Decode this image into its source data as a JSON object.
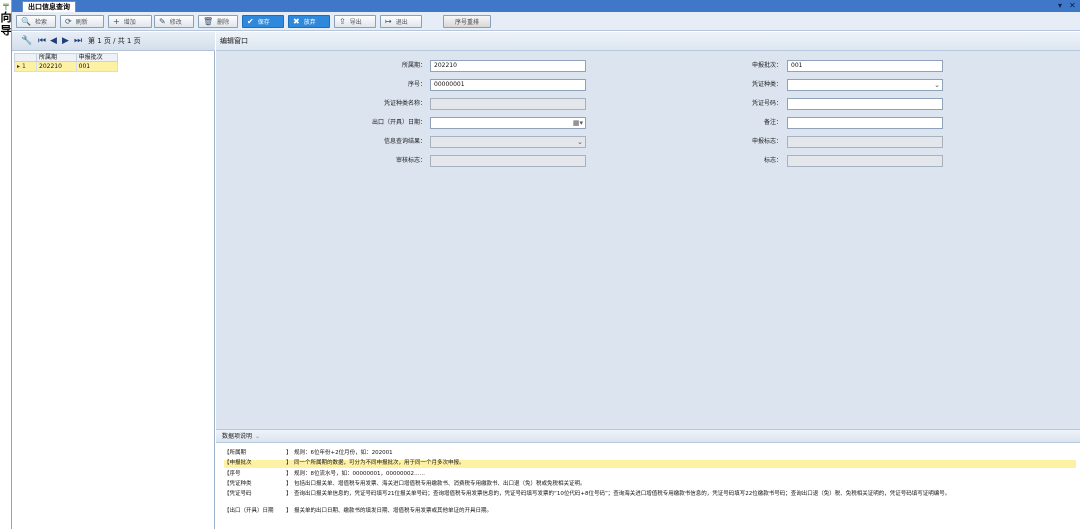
{
  "nav": {
    "label": "向导"
  },
  "tab": {
    "title": "出口信息查询"
  },
  "window_controls": {
    "dropdown": "▾",
    "close": "✕"
  },
  "toolbar": {
    "search": "检索",
    "refresh": "刷新",
    "add": "增加",
    "edit": "修改",
    "delete": "删除",
    "save": "保存",
    "discard": "放弃",
    "export": "导出",
    "exit": "退出",
    "reorder": "序号重排"
  },
  "pager": {
    "text": "第 1 页 / 共 1 页"
  },
  "grid": {
    "columns": [
      "所属期",
      "申报批次"
    ],
    "rows": [
      {
        "index": "1",
        "period": "202210",
        "batch": "001"
      }
    ]
  },
  "edit": {
    "header": "编辑窗口",
    "fields": {
      "period": {
        "label": "所属期：",
        "value": "202210"
      },
      "batch": {
        "label": "申报批次：",
        "value": "001"
      },
      "seq": {
        "label": "序号：",
        "value": "00000001"
      },
      "voucher_type": {
        "label": "凭证种类：",
        "value": ""
      },
      "voucher_type_name": {
        "label": "凭证种类名称：",
        "value": ""
      },
      "voucher_no": {
        "label": "凭证号码：",
        "value": ""
      },
      "export_date": {
        "label": "出口（开具）日期：",
        "value": ""
      },
      "remark": {
        "label": "备注：",
        "value": ""
      },
      "query_result": {
        "label": "信息查询结果：",
        "value": ""
      },
      "declare_flag": {
        "label": "申报标志：",
        "value": ""
      },
      "audit_flag": {
        "label": "审核标志：",
        "value": ""
      },
      "flag": {
        "label": "标志：",
        "value": ""
      }
    }
  },
  "desc": {
    "header": "数据项说明",
    "bracket": "】",
    "rows": [
      {
        "key": "【所属期",
        "text": "规则：6位年份+2位月份，如：202001"
      },
      {
        "key": "【申报批次",
        "text": "同一个所属期的数据，可分为不同申报批次，用于同一个月多次申报。"
      },
      {
        "key": "【序号",
        "text": "规则：8位流水号，如：00000001，00000002……"
      },
      {
        "key": "【凭证种类",
        "text": "包括出口报关单、增值税专用发票、海关进口增值税专用缴款书、消费税专用缴款书、出口退（免）税或免税相关证明。"
      },
      {
        "key": "【凭证号码",
        "text": "查询出口报关单信息的，凭证号码填写21位报关单号码；查询增值税专用发票信息的，凭证号码填写发票的“10位代码+8位号码”；查询海关进口增值税专用缴款书信息的，凭证号码填写22位缴款书号码；查询出口退（免）税、免税相关证明的，凭证号码填写证明编号。"
      },
      {
        "key": "【出口（开具）日期",
        "text": "报关单的出口日期、缴款书的填发日期、增值税专用发票或其他单证的开具日期。"
      }
    ]
  }
}
